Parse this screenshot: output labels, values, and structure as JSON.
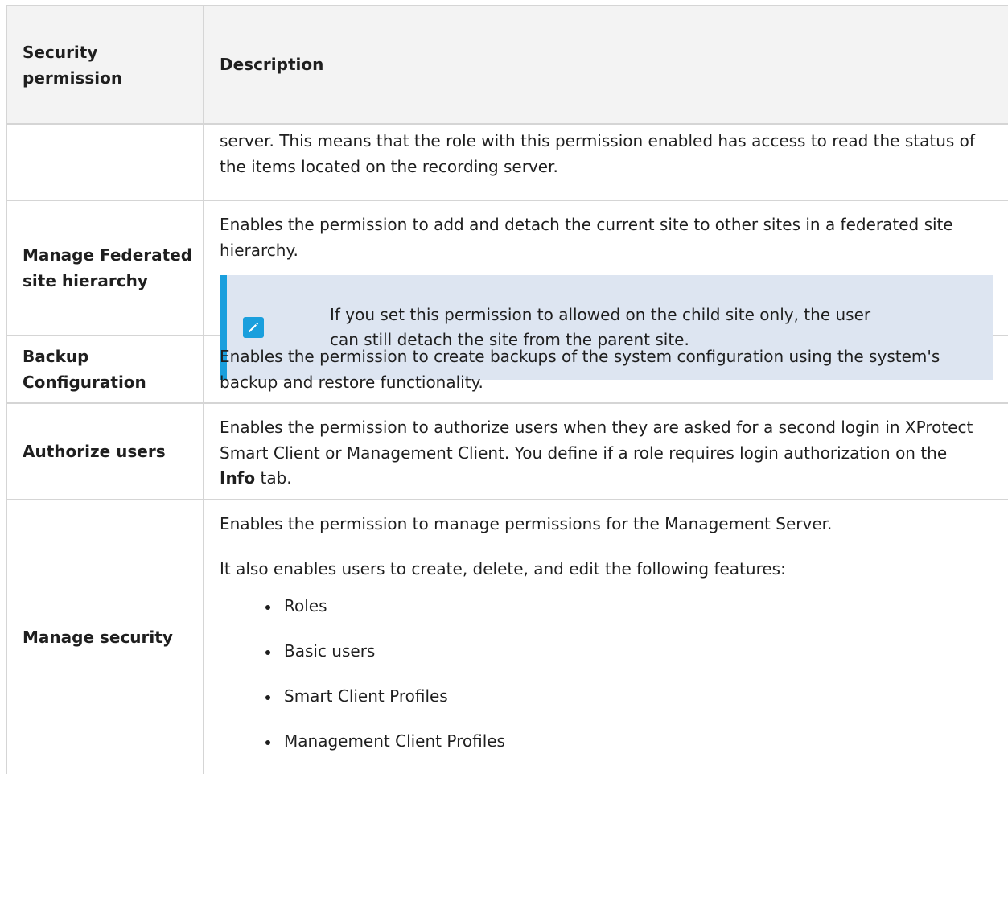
{
  "table": {
    "header": {
      "col1": "Security permission",
      "col2": "Description"
    },
    "rows": [
      {
        "permission": "",
        "description": "server. This means that the role with this permission enabled has access to read the status of the items located on the recording server."
      },
      {
        "permission": "Manage Federated site hierarchy",
        "description": "Enables the permission to add and detach the current site to other sites in a federated site hierarchy.",
        "note": {
          "icon": "pencil-icon",
          "text": "If you set this permission to allowed on the child site only, the user can still detach the site from the parent site."
        }
      },
      {
        "permission": "Backup Configuration",
        "description": "Enables the permission to create backups of the system configuration using the system's backup and restore functionality."
      },
      {
        "permission": "Authorize users",
        "description_before": "Enables the permission to authorize users when they are asked for a second login in XProtect Smart Client or Management Client. You define if a role requires login authorization on the ",
        "description_bold": "Info",
        "description_after": " tab."
      },
      {
        "permission": "Manage security",
        "description": "Enables the permission to manage permissions for the Management Server.",
        "description2": "It also enables users to create, delete, and edit the following features:",
        "features": [
          "Roles",
          "Basic users",
          "Smart Client Profiles",
          "Management Client Profiles"
        ]
      }
    ]
  },
  "colors": {
    "note_background": "#dde5f1",
    "note_accent": "#1a9fdd",
    "header_background": "#f3f3f3"
  }
}
